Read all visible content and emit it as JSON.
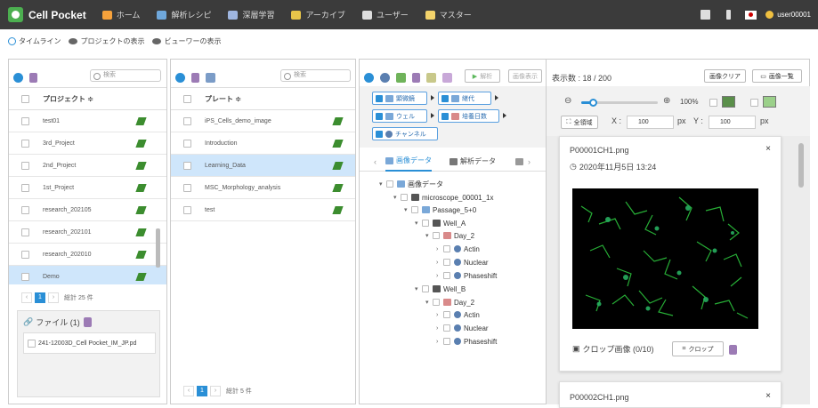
{
  "app": {
    "title": "Cell Pocket"
  },
  "nav": [
    {
      "label": "ホーム",
      "icon": "home-icon",
      "color": "#f7a23b"
    },
    {
      "label": "解析レシピ",
      "icon": "recipe-icon",
      "color": "#6fa8dc"
    },
    {
      "label": "深層学習",
      "icon": "graduation-cap-icon",
      "color": "#9fb6e0"
    },
    {
      "label": "アーカイブ",
      "icon": "archive-icon",
      "color": "#e8c54a"
    },
    {
      "label": "ユーザー",
      "icon": "user-icon",
      "color": "#dddddd"
    },
    {
      "label": "マスター",
      "icon": "document-icon",
      "color": "#f3d36b"
    }
  ],
  "header_right": {
    "user": "user00001"
  },
  "subbar": {
    "timeline": "タイムライン",
    "project_view": "プロジェクトの表示",
    "viewer_view": "ビューワーの表示"
  },
  "project_panel": {
    "search_placeholder": "検索",
    "column": "プロジェクト ≑",
    "rows": [
      "test01",
      "3rd_Project",
      "2nd_Project",
      "1st_Project",
      "research_202105",
      "research_202101",
      "research_202010",
      "Demo"
    ],
    "page": "1",
    "total": "総計 25 件"
  },
  "file_panel": {
    "title": "ファイル (1)",
    "file": "241-12003D_Cell Pocket_IM_JP.pd"
  },
  "plate_panel": {
    "search_placeholder": "検索",
    "column": "プレート ≑",
    "rows": [
      "iPS_Cells_demo_image",
      "Introduction",
      "Learning_Data",
      "MSC_Morphology_analysis",
      "test"
    ],
    "page": "1",
    "total": "総計 5 件"
  },
  "data_panel": {
    "analyze_btn": "解析",
    "image_display_btn": "画像表示",
    "chips": {
      "microscope": "顕微鏡",
      "passage": "継代",
      "well": "ウェル",
      "days": "培養日数",
      "channel": "チャンネル"
    },
    "tabs": {
      "image_data": "画像データ",
      "analysis_data": "解析データ"
    },
    "tree": {
      "root": "画像データ",
      "microscope": "microscope_00001_1x",
      "passage": "Passage_5+0",
      "well_a": "Well_A",
      "day_a": "Day_2",
      "well_b": "Well_B",
      "day_b": "Day_2",
      "ch1": "Actin",
      "ch2": "Nuclear",
      "ch3": "Phaseshift"
    }
  },
  "viewer": {
    "count_text": "表示数 : 18 / 200",
    "clear_btn": "画像クリア",
    "list_btn": "画像一覧",
    "zoom": "100%",
    "full_btn": "全領域",
    "x_label": "X :",
    "x_value": "100",
    "y_label": "Y :",
    "y_value": "100",
    "px": "px",
    "slider_value": 0.15,
    "card1": {
      "filename": "P00001CH1.png",
      "date": "2020年11月5日 13:24",
      "crop_label": "クロップ画像 (0/10)",
      "crop_btn": "クロップ"
    },
    "card2": {
      "filename": "P00002CH1.png"
    }
  }
}
